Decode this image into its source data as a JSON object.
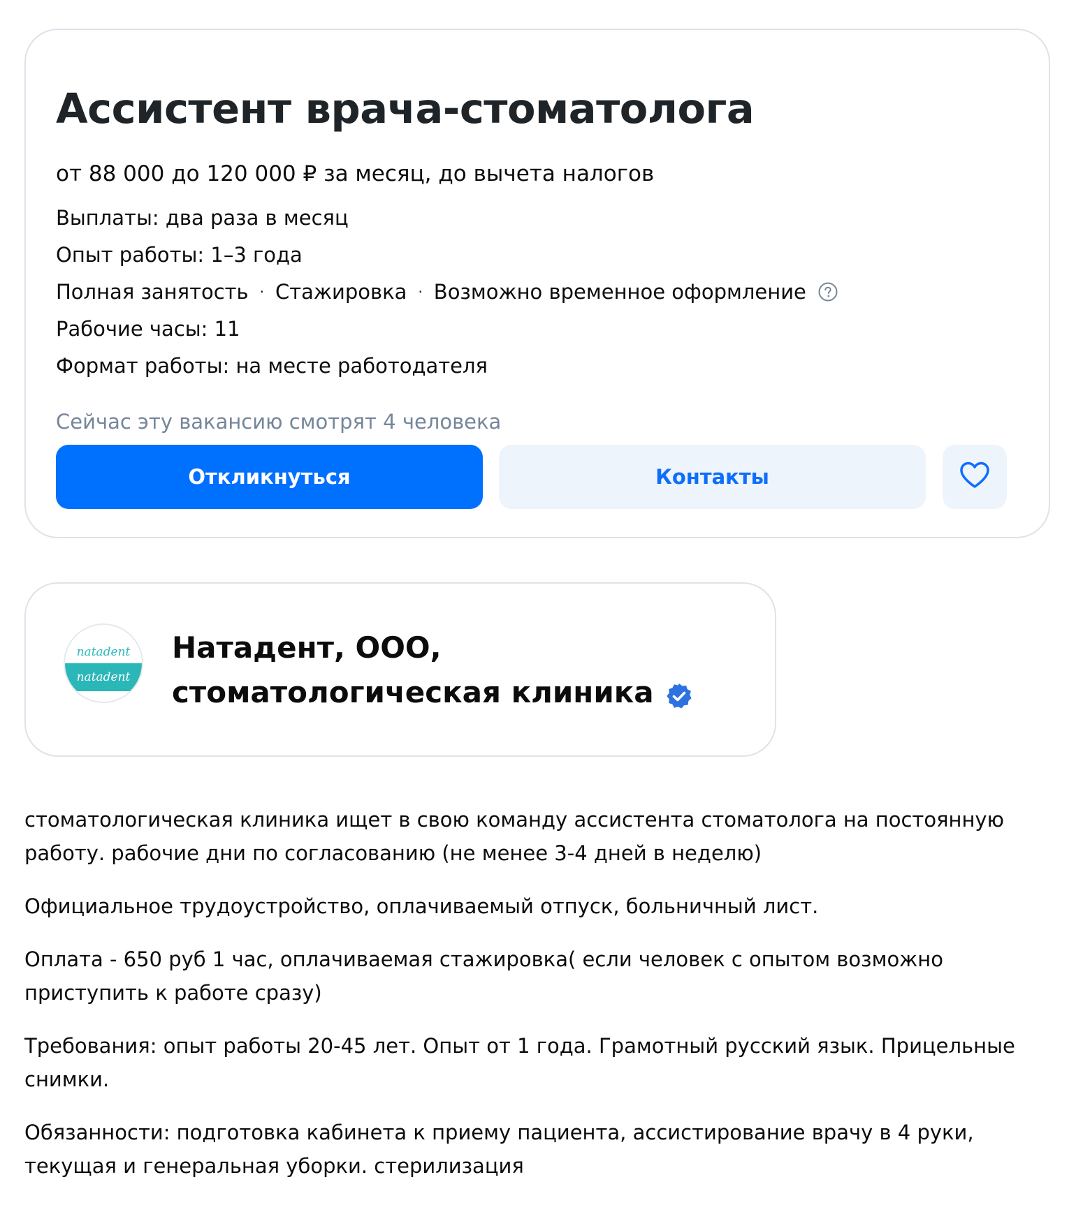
{
  "vacancy": {
    "title": "Ассистент врача-стоматолога",
    "salary": "от 88 000 до 120 000 ₽ за месяц, до вычета налогов",
    "payments": "Выплаты: два раза в месяц",
    "experience": "Опыт работы: 1–3 года",
    "employment_types": [
      "Полная занятость",
      "Стажировка",
      "Возможно временное оформление"
    ],
    "separator": "·",
    "hours": "Рабочие часы: 11",
    "work_format": "Формат работы: на месте работодателя",
    "viewers": "Сейчас эту вакансию смотрят 4 человека",
    "help_icon": "question-circle-icon"
  },
  "actions": {
    "apply_label": "Откликнуться",
    "contacts_label": "Контакты",
    "favorite_icon": "heart-icon"
  },
  "employer": {
    "name": "Натадент, ООО, стоматологическая клиника",
    "logo_top_text": "natadent",
    "logo_band_text": "natadent",
    "verified_icon": "verified-check-icon"
  },
  "description": [
    "стоматологическая клиника ищет в свою команду ассистента стоматолога на постоянную работу. рабочие дни по согласованию (не менее 3-4 дней в неделю)",
    "Официальное трудоустройство, оплачиваемый отпуск, больничный лист.",
    "Оплата - 650 руб 1 час, оплачиваемая стажировка( если человек с опытом возможно приступить к работе сразу)",
    "Требования: опыт работы 20-45 лет. Опыт от 1 года. Грамотный русский язык. Прицельные снимки.",
    "Обязанности: подготовка кабинета к приему пациента, ассистирование врачу в 4 руки, текущая и генеральная уборки. стерилизация"
  ],
  "colors": {
    "accent": "#0070ff",
    "secondary_button_bg": "#eef4fc",
    "muted_text": "#75869a",
    "border": "#dde3ea",
    "logo_teal": "#2bb6b8"
  }
}
